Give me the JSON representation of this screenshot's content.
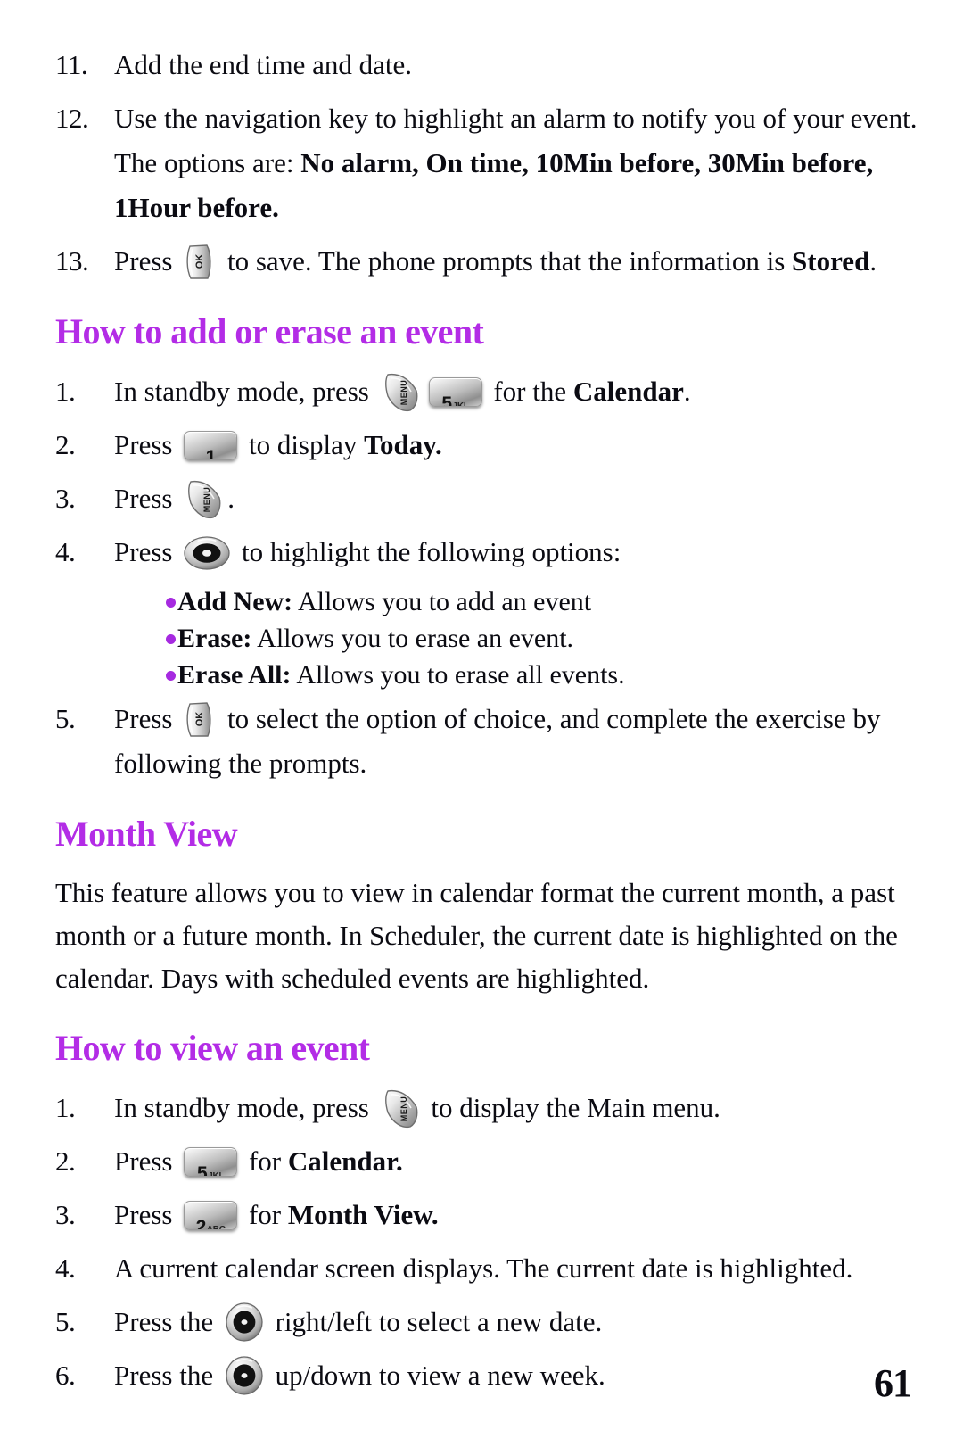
{
  "page": {
    "number": "61",
    "heading_color": "#b32ce6",
    "bullet_color": "#a62ae0",
    "text_color": "#0b0b12",
    "background": "#ffffff"
  },
  "continued_steps": [
    {
      "num": "11.",
      "lines": [
        [
          {
            "t": "Add the end time and date.",
            "bold": false
          }
        ]
      ]
    },
    {
      "num": "12.",
      "lines": [
        [
          {
            "t": "Use the navigation key to highlight an alarm to notify you of your event.",
            "bold": false
          }
        ],
        [
          {
            "t": "The options are: ",
            "bold": false
          },
          {
            "t": "No alarm, On time, 10Min before, 30Min before,",
            "bold": true
          }
        ],
        [
          {
            "t": "1Hour before.",
            "bold": true
          }
        ]
      ]
    },
    {
      "num": "13.",
      "lines": [
        [
          {
            "t": "Press ",
            "bold": false
          },
          {
            "icon": "ok-key"
          },
          {
            "t": " to save. The phone prompts that the information is ",
            "bold": false
          },
          {
            "t": "Stored",
            "bold": true
          },
          {
            "t": ".",
            "bold": false
          }
        ]
      ]
    }
  ],
  "sections": [
    {
      "heading": "How to add or erase an event",
      "steps": [
        {
          "num": "1.",
          "lines": [
            [
              {
                "t": "In standby mode, press ",
                "bold": false
              },
              {
                "icon": "menu-key"
              },
              {
                "icon": "key-5-jkl"
              },
              {
                "t": " for the ",
                "bold": false
              },
              {
                "t": "Calendar",
                "bold": true
              },
              {
                "t": ".",
                "bold": false
              }
            ]
          ]
        },
        {
          "num": "2.",
          "lines": [
            [
              {
                "t": "Press ",
                "bold": false
              },
              {
                "icon": "key-1"
              },
              {
                "t": " to display ",
                "bold": false
              },
              {
                "t": "Today.",
                "bold": true
              }
            ]
          ]
        },
        {
          "num": "3.",
          "lines": [
            [
              {
                "t": "Press ",
                "bold": false
              },
              {
                "icon": "menu-key"
              },
              {
                "t": ".",
                "bold": false
              }
            ]
          ]
        },
        {
          "num": "4.",
          "lines": [
            [
              {
                "t": "Press ",
                "bold": false
              },
              {
                "icon": "nav-key"
              },
              {
                "t": " to highlight the following options:",
                "bold": false
              }
            ]
          ]
        }
      ],
      "bullets": [
        {
          "label": "Add New:",
          "text": " Allows you to add an event"
        },
        {
          "label": "Erase:",
          "text": " Allows you to erase an event."
        },
        {
          "label": "Erase All:",
          "text": " Allows you to erase all events."
        }
      ],
      "steps_after_bullets": [
        {
          "num": "5.",
          "lines": [
            [
              {
                "t": "Press ",
                "bold": false
              },
              {
                "icon": "ok-key"
              },
              {
                "t": " to select the option of choice, and complete the exercise by",
                "bold": false
              }
            ],
            [
              {
                "t": "following the prompts.",
                "bold": false
              }
            ]
          ]
        }
      ]
    },
    {
      "heading": "Month View",
      "paragraph_lines": [
        "This feature allows you to view in calendar format the current month, a past",
        "month or a future month. In Scheduler, the current date is highlighted on the",
        "calendar. Days with scheduled events are highlighted."
      ]
    },
    {
      "heading": "How to view an event",
      "steps": [
        {
          "num": "1.",
          "lines": [
            [
              {
                "t": "In standby mode, press ",
                "bold": false
              },
              {
                "icon": "menu-key"
              },
              {
                "t": " to display the Main menu.",
                "bold": false
              }
            ]
          ]
        },
        {
          "num": "2.",
          "lines": [
            [
              {
                "t": "Press ",
                "bold": false
              },
              {
                "icon": "key-5-jkl"
              },
              {
                "t": " for ",
                "bold": false
              },
              {
                "t": "Calendar.",
                "bold": true
              }
            ]
          ]
        },
        {
          "num": "3.",
          "lines": [
            [
              {
                "t": "Press ",
                "bold": false
              },
              {
                "icon": "key-2-abc"
              },
              {
                "t": " for ",
                "bold": false
              },
              {
                "t": "Month View.",
                "bold": true
              }
            ]
          ]
        },
        {
          "num": "4.",
          "lines": [
            [
              {
                "t": "A current calendar screen displays. The current date is highlighted.",
                "bold": false
              }
            ]
          ]
        },
        {
          "num": "5.",
          "lines": [
            [
              {
                "t": "Press the ",
                "bold": false
              },
              {
                "icon": "nav-key-tall"
              },
              {
                "t": " right/left to select a new date.",
                "bold": false
              }
            ]
          ]
        },
        {
          "num": "6.",
          "lines": [
            [
              {
                "t": "Press the ",
                "bold": false
              },
              {
                "icon": "nav-key-tall"
              },
              {
                "t": " up/down to view a new week.",
                "bold": false
              }
            ]
          ]
        }
      ]
    }
  ],
  "icons": {
    "ok-key": {
      "label": "OK",
      "name": "ok-select-key-icon"
    },
    "menu-key": {
      "label": "MENU",
      "name": "menu-soft-key-icon"
    },
    "key-1": {
      "digit": "1",
      "letters": "",
      "name": "keypad-1-key-icon"
    },
    "key-2-abc": {
      "digit": "2",
      "letters": "ABC",
      "name": "keypad-2-abc-key-icon"
    },
    "key-5-jkl": {
      "digit": "5",
      "letters": "JKL",
      "name": "keypad-5-jkl-key-icon"
    },
    "nav-key": {
      "name": "navigation-key-icon"
    },
    "nav-key-tall": {
      "name": "navigation-key-icon"
    }
  }
}
